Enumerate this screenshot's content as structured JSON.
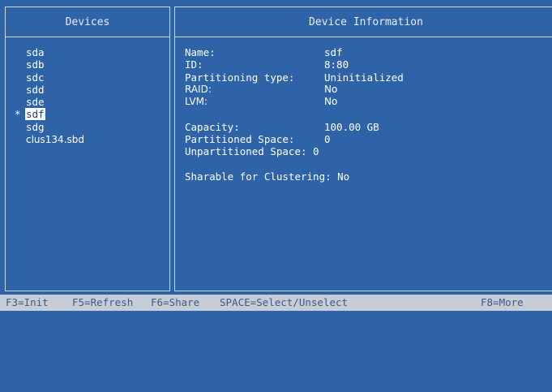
{
  "left_panel": {
    "title": "Devices",
    "selected_marker": "*",
    "devices": [
      "sda",
      "sdb",
      "sdc",
      "sdd",
      "sde",
      "sdf",
      "sdg",
      "clus134.sbd"
    ]
  },
  "right_panel": {
    "title": "Device Information",
    "fields": [
      {
        "label": "Name:",
        "value": "sdf"
      },
      {
        "label": "ID:",
        "value": "8:80"
      },
      {
        "label": "Partitioning type:",
        "value": "Uninitialized"
      },
      {
        "label": "RAID:",
        "value": "No"
      },
      {
        "label": "LVM:",
        "value": "No"
      }
    ],
    "fields2": [
      {
        "label": "Capacity:",
        "value": "100.00 GB"
      },
      {
        "label": "Partitioned Space:",
        "value": "0"
      },
      {
        "label": "Unpartitioned Space:",
        "value": "0"
      }
    ],
    "sharable": "Sharable for Clustering: No"
  },
  "status_bar": {
    "f3": "F3=Init",
    "f5": "F5=Refresh",
    "f6": "F6=Share",
    "space": "SPACE=Select/Unselect",
    "f8": "F8=More"
  },
  "colors": {
    "background": "#2f63a8",
    "selection_bg": "#ffffff",
    "status_bar_bg": "#c7cdd6"
  }
}
